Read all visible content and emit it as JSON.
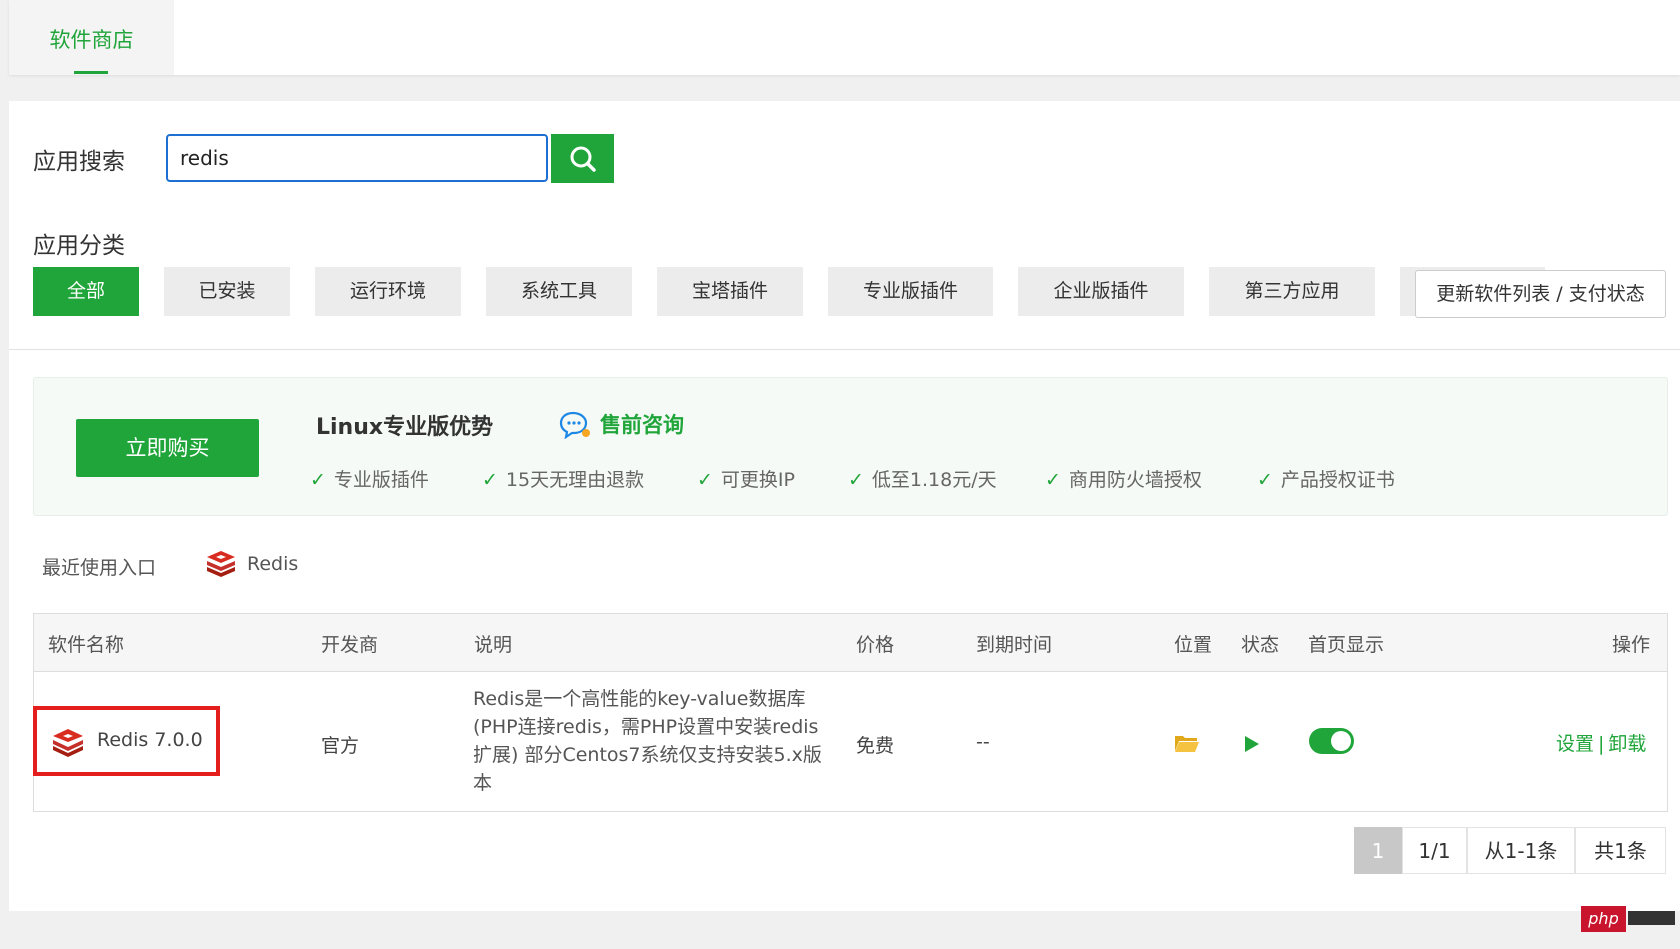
{
  "tabs": [
    {
      "label": "软件商店",
      "active": true
    }
  ],
  "search": {
    "label": "应用搜索",
    "value": "redis"
  },
  "category": {
    "label": "应用分类",
    "items": [
      "全部",
      "已安装",
      "运行环境",
      "系统工具",
      "宝塔插件",
      "专业版插件",
      "企业版插件",
      "第三方应用"
    ],
    "active_index": 0,
    "update_button": "更新软件列表 / 支付状态"
  },
  "promo": {
    "buy_button": "立即购买",
    "title": "Linux专业版优势",
    "consult": "售前咨询",
    "features": [
      "专业版插件",
      "15天无理由退款",
      "可更换IP",
      "低至1.18元/天",
      "商用防火墙授权",
      "产品授权证书"
    ]
  },
  "recent": {
    "label": "最近使用入口",
    "item": "Redis"
  },
  "table": {
    "headers": [
      "软件名称",
      "开发商",
      "说明",
      "价格",
      "到期时间",
      "位置",
      "状态",
      "首页显示",
      "操作"
    ],
    "rows": [
      {
        "name": "Redis 7.0.0",
        "developer": "官方",
        "description": "Redis是一个高性能的key-value数据库(PHP连接redis，需PHP设置中安装redis扩展) 部分Centos7系统仅支持安装5.x版本",
        "price": "免费",
        "expiry": "--",
        "location_icon": "folder-icon",
        "status_icon": "play-icon",
        "homepage_display": true,
        "actions": {
          "settings": "设置",
          "separator": "|",
          "uninstall": "卸载"
        }
      }
    ]
  },
  "pagination": {
    "current": "1",
    "pages": "1/1",
    "range": "从1-1条",
    "total": "共1条"
  },
  "watermark": "php",
  "colors": {
    "accent": "#20a53a",
    "highlight": "#e41d1d",
    "focus": "#1e6fd2"
  }
}
